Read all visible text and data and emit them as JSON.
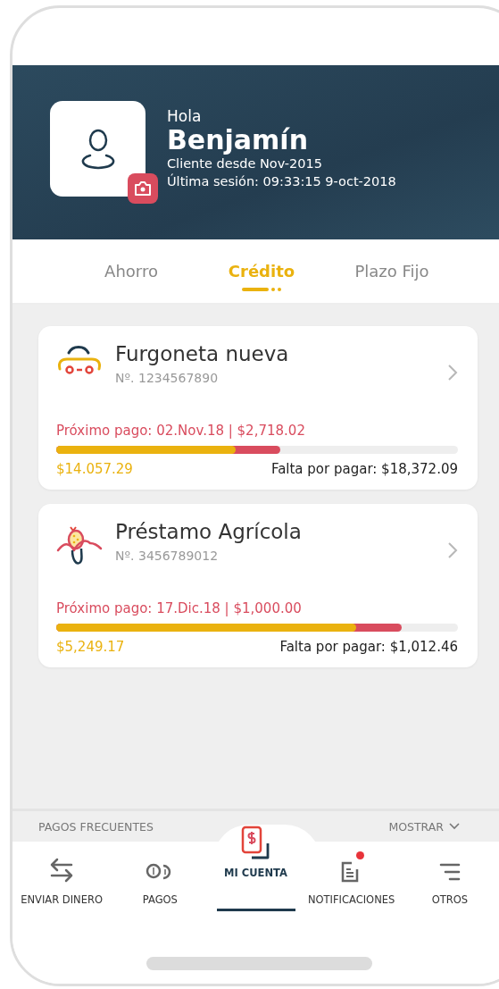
{
  "profile": {
    "greeting": "Hola",
    "name": "Benjamín",
    "client_since": "Cliente desde Nov-2015",
    "last_session": "Última sesión: 09:33:15 9-oct-2018"
  },
  "tabs": [
    {
      "label": "Ahorro",
      "selected": false
    },
    {
      "label": "Crédito",
      "selected": true
    },
    {
      "label": "Plazo Fijo",
      "selected": false
    }
  ],
  "loans": [
    {
      "kind": "van",
      "title": "Furgoneta nueva",
      "number": "Nº. 1234567890",
      "next_payment": "Próximo pago: 02.Nov.18 | $2,718.02",
      "paid": {
        "level": 0.447
      },
      "due": {
        "level": 0.558
      },
      "paid_amount": "$14.057.29",
      "remaining": "Falta por pagar: $18,372.09"
    },
    {
      "kind": "corn",
      "title": "Préstamo Agrícola",
      "number": "Nº. 3456789012",
      "next_payment": "Próximo pago: 17.Dic.18 | $1,000.00",
      "paid": {
        "level": 0.747
      },
      "due": {
        "level": 0.86
      },
      "paid_amount": "$5,249.17",
      "remaining": "Falta por pagar: $1,012.46"
    }
  ],
  "frequent_payments": {
    "title": "PAGOS FRECUENTES",
    "toggle": "MOSTRAR"
  },
  "nav": [
    {
      "kind": "transfer",
      "label": "ENVIAR DINERO",
      "selected": false,
      "badge": false
    },
    {
      "kind": "coins",
      "label": "PAGOS",
      "selected": false,
      "badge": false
    },
    {
      "kind": "account",
      "label": "MI CUENTA",
      "selected": true,
      "badge": false
    },
    {
      "kind": "notes",
      "label": "NOTIFICACIONES",
      "selected": false,
      "badge": true
    },
    {
      "kind": "menu",
      "label": "OTROS",
      "selected": false,
      "badge": false
    }
  ]
}
